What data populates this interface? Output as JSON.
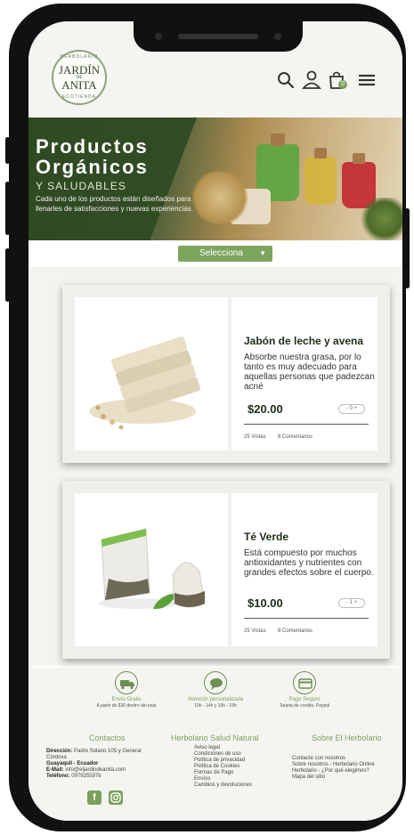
{
  "brand": {
    "logo_top": "HERBOLARIO",
    "logo_line1": "JARDÍN",
    "logo_line2": "DE",
    "logo_line3": "ANITA",
    "logo_bottom": "ECOTIENDA"
  },
  "header": {
    "cart_count": "0",
    "icons": [
      "search-icon",
      "user-icon",
      "cart-icon",
      "menu-icon"
    ]
  },
  "hero": {
    "title_line1": "Productos",
    "title_line2": "Orgánicos",
    "subtitle": "Y SALUDABLES",
    "description": "Cada uno de los productos están diseñados para llenarles de satisfacciones y nuevas experiencias."
  },
  "filter": {
    "select_label": "Selecciona"
  },
  "products": [
    {
      "name": "Jabón de leche y avena",
      "description": "Absorbe nuestra grasa, por lo tanto es muy adecuado para aquellas personas que padezcan acné",
      "price": "$20.00",
      "qty": "- 0 +",
      "views": "25 Vistas",
      "comments": "8 Comentarios"
    },
    {
      "name": "Té Verde",
      "description": "Está compuesto por muchos antioxidantes y nutrientes con grandes efectos sobre el cuerpo.",
      "price": "$10.00",
      "qty": "- 1 +",
      "views": "25 Vistas",
      "comments": "8 Comentarios"
    }
  ],
  "features": [
    {
      "title": "Envío Gratis",
      "subtitle": "A partir de $30 dentro del país",
      "icon": "truck-icon"
    },
    {
      "title": "Atención personalizada",
      "subtitle": "10h - 14h y 16h - 19h",
      "icon": "chat-icon"
    },
    {
      "title": "Pago Seguro",
      "subtitle": "Tarjeta de credito, Paypal",
      "icon": "card-icon"
    }
  ],
  "footer": {
    "contacts": {
      "heading": "Contactos",
      "address_label": "Dirección:",
      "address": "Padre Solano 105 y General Córdova",
      "city": "Guayaquil - Ecuador",
      "email_label": "E-Mail:",
      "email": "info@eljardindeanita.com",
      "phone_label": "Teléfono:",
      "phone": "097925597b"
    },
    "herbolario": {
      "heading": "Herbolario Salud Natural",
      "links": [
        "Aviso legal",
        "Condiciones de uso",
        "Política de privacidad",
        "Política de Cookies",
        "Formas de Pago",
        "Envíos",
        "Cambios y devoluciones"
      ]
    },
    "sobre": {
      "heading": "Sobre El Herbolario",
      "links": [
        "Contacte con nosotros",
        "Sobre nosotros - Herbolario Online",
        "Herbolario - ¿Por qué elegimos?",
        "Mapa del sitio"
      ]
    },
    "social": [
      "facebook-icon",
      "instagram-icon"
    ]
  },
  "colors": {
    "accent": "#7aa05c",
    "dark_green": "#2f4a23"
  }
}
